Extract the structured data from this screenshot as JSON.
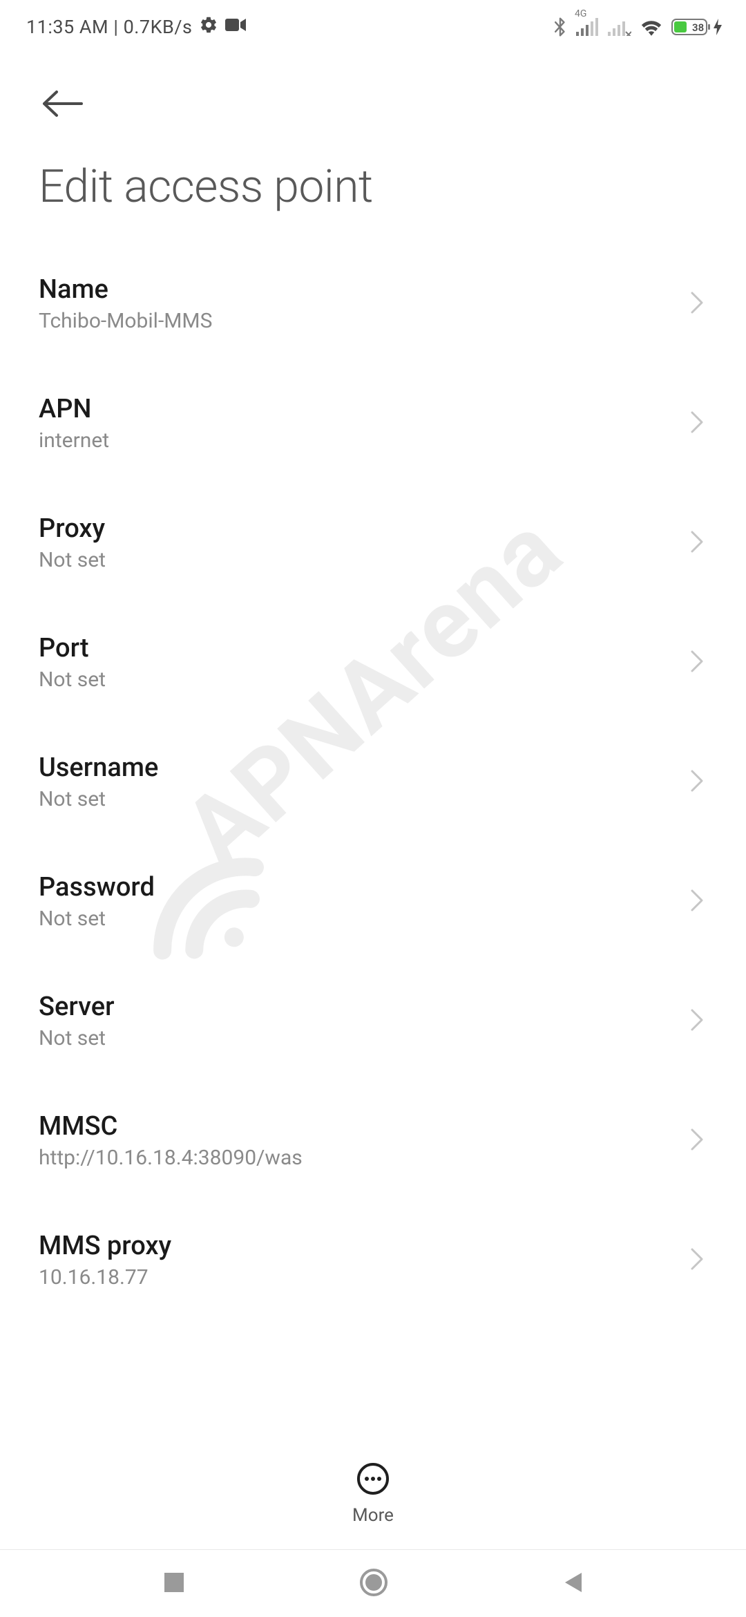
{
  "status": {
    "time": "11:35 AM",
    "separator": "|",
    "speed": "0.7KB/s",
    "network_label": "4G",
    "battery": "38"
  },
  "header": {
    "title": "Edit access point"
  },
  "settings": [
    {
      "label": "Name",
      "value": "Tchibo-Mobil-MMS"
    },
    {
      "label": "APN",
      "value": "internet"
    },
    {
      "label": "Proxy",
      "value": "Not set"
    },
    {
      "label": "Port",
      "value": "Not set"
    },
    {
      "label": "Username",
      "value": "Not set"
    },
    {
      "label": "Password",
      "value": "Not set"
    },
    {
      "label": "Server",
      "value": "Not set"
    },
    {
      "label": "MMSC",
      "value": "http://10.16.18.4:38090/was"
    },
    {
      "label": "MMS proxy",
      "value": "10.16.18.77"
    }
  ],
  "bottom": {
    "more_label": "More"
  },
  "watermark": "APNArena"
}
